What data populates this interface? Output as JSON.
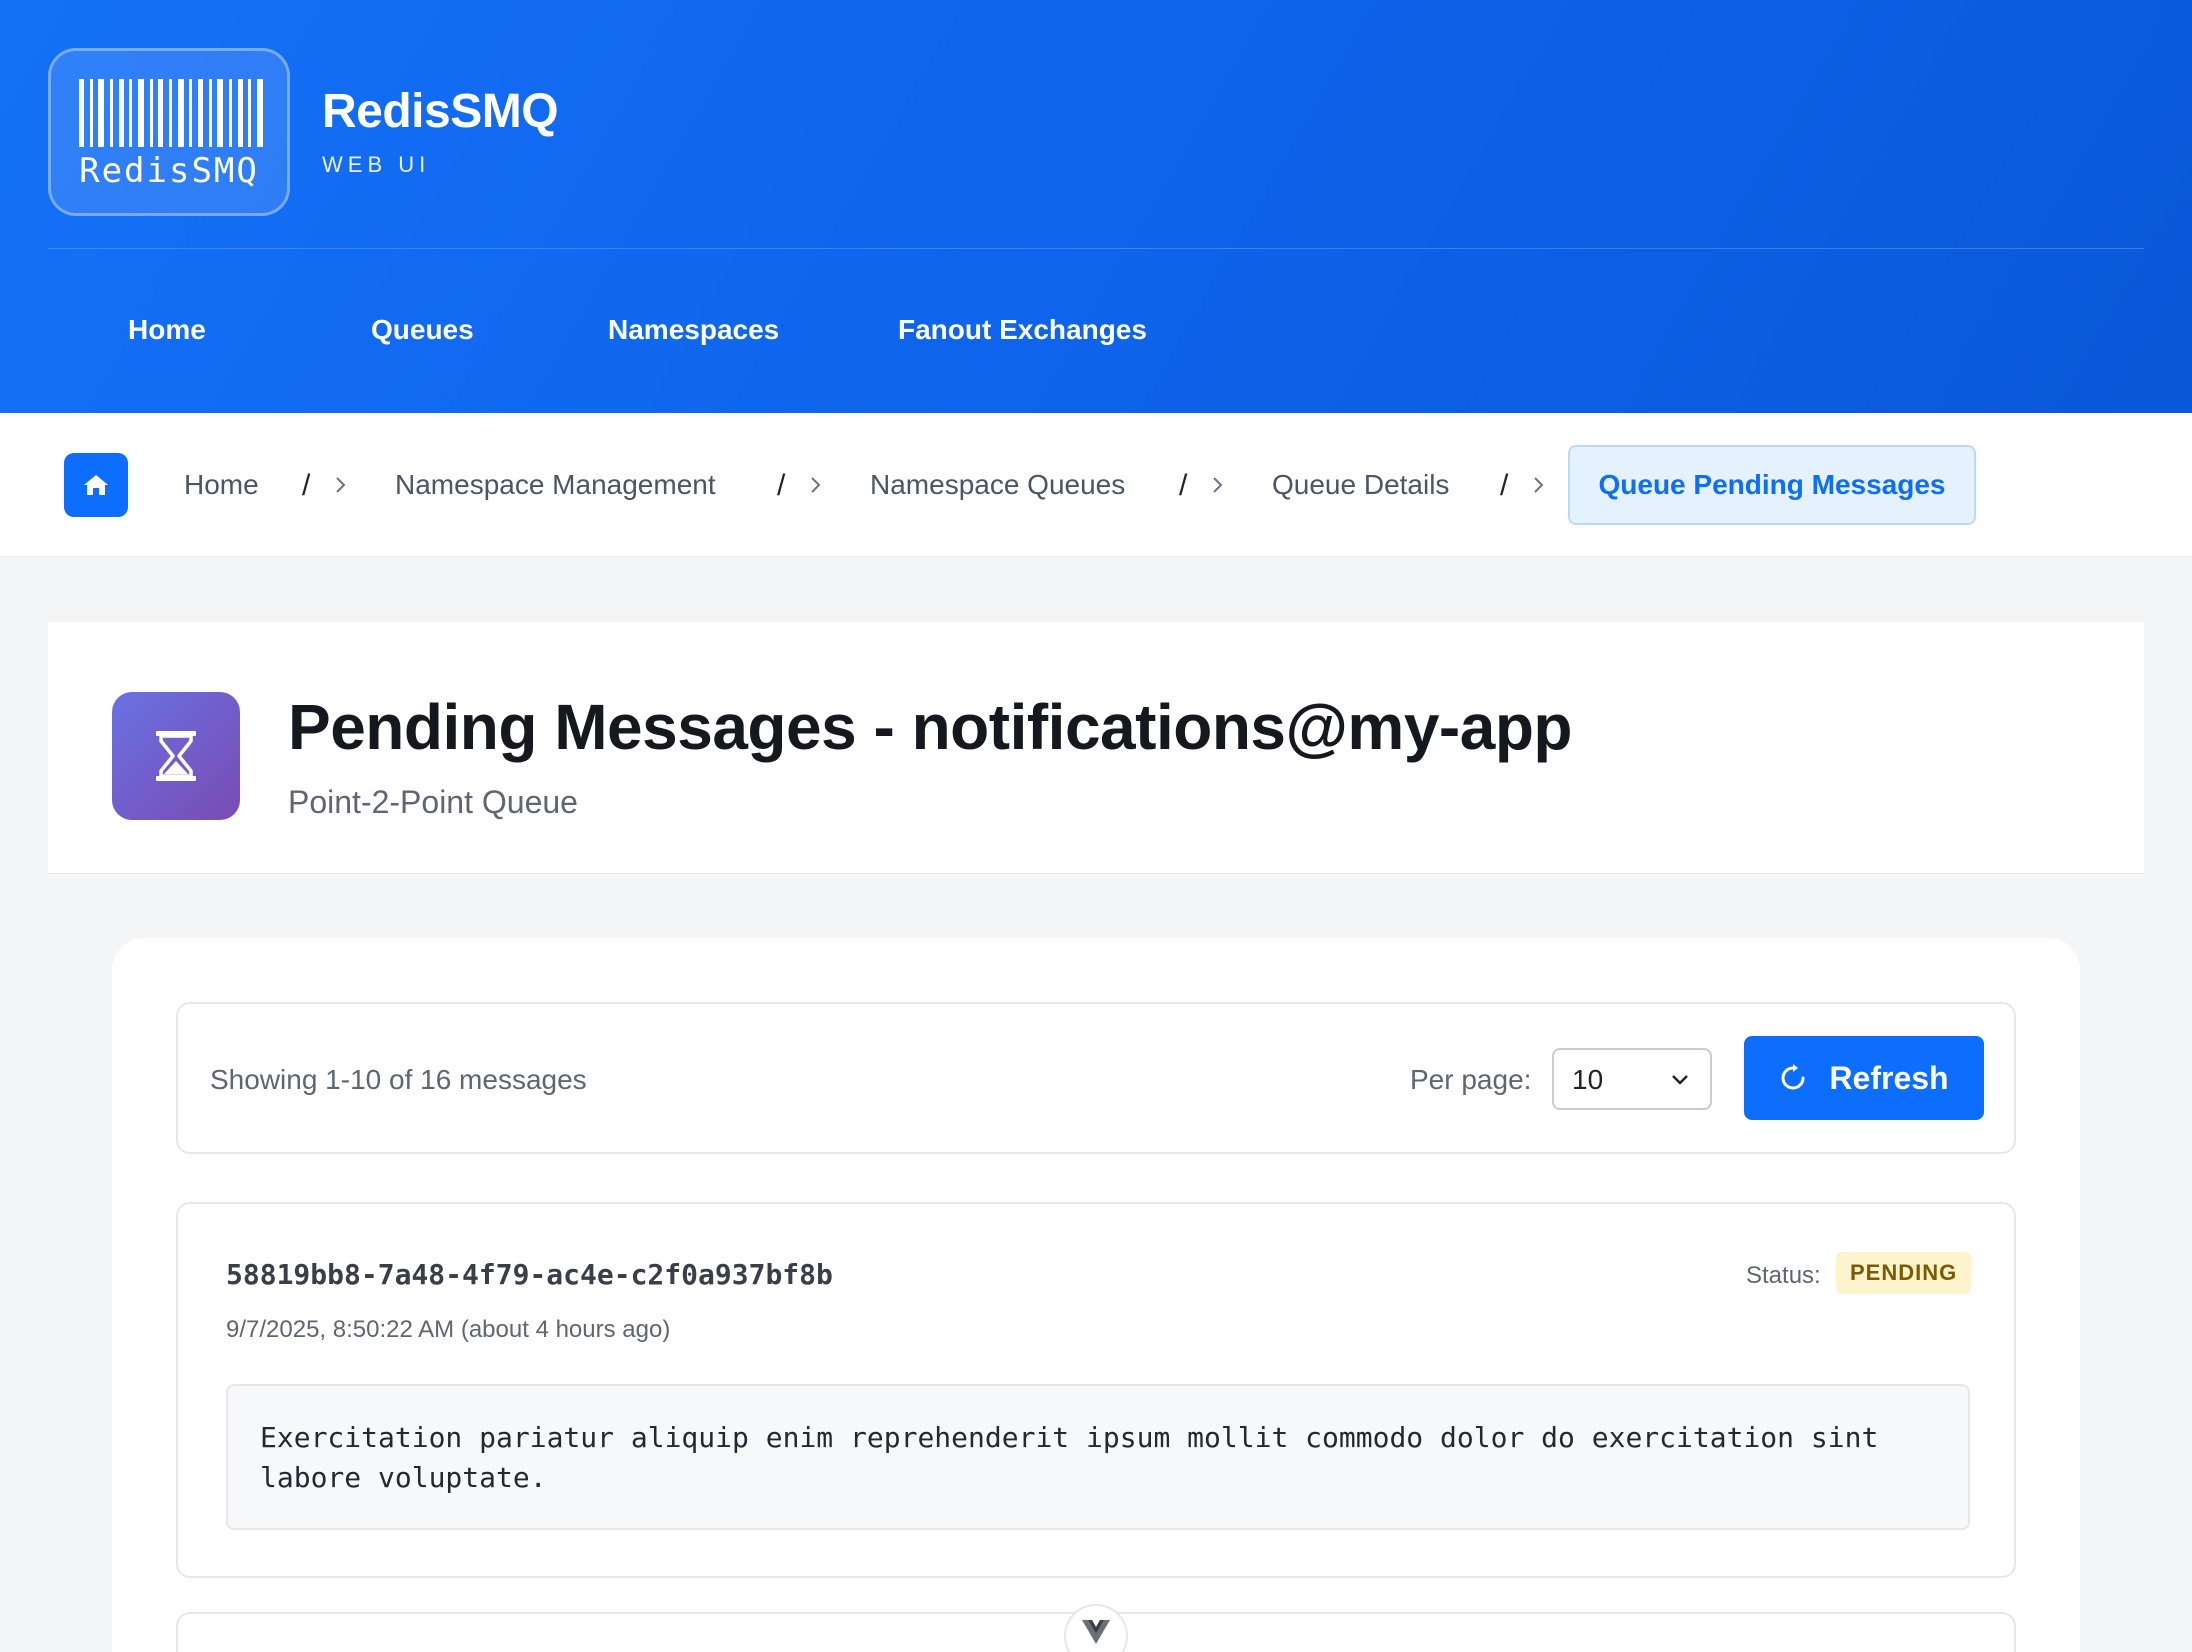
{
  "brand": {
    "logo_text": "RedisSMQ",
    "title": "RedisSMQ",
    "subtitle": "WEB UI"
  },
  "nav": {
    "items": [
      {
        "label": "Home"
      },
      {
        "label": "Queues"
      },
      {
        "label": "Namespaces"
      },
      {
        "label": "Fanout Exchanges"
      }
    ]
  },
  "breadcrumb": {
    "home_icon": "home-icon",
    "items": [
      {
        "label": "Home"
      },
      {
        "label": "Namespace Management"
      },
      {
        "label": "Namespace Queues"
      },
      {
        "label": "Queue Details"
      }
    ],
    "separator": "/",
    "active": "Queue Pending Messages"
  },
  "page": {
    "icon": "hourglass-icon",
    "title": "Pending Messages - notifications@my-app",
    "subtitle": "Point-2-Point Queue"
  },
  "toolbar": {
    "showing": "Showing 1-10 of 16 messages",
    "per_page_label": "Per page:",
    "per_page_value": "10",
    "refresh_label": "Refresh"
  },
  "messages": [
    {
      "id": "58819bb8-7a48-4f79-ac4e-c2f0a937bf8b",
      "time": "9/7/2025, 8:50:22 AM (about 4 hours ago)",
      "status_label": "Status:",
      "status": "PENDING",
      "body": "Exercitation pariatur aliquip enim reprehenderit ipsum mollit commodo dolor do exercitation sint labore voluptate."
    }
  ],
  "colors": {
    "header": "#0d63ea",
    "accent": "#0d6efd",
    "pending_badge_bg": "#fdf3cd",
    "pending_badge_text": "#7a5b00"
  }
}
